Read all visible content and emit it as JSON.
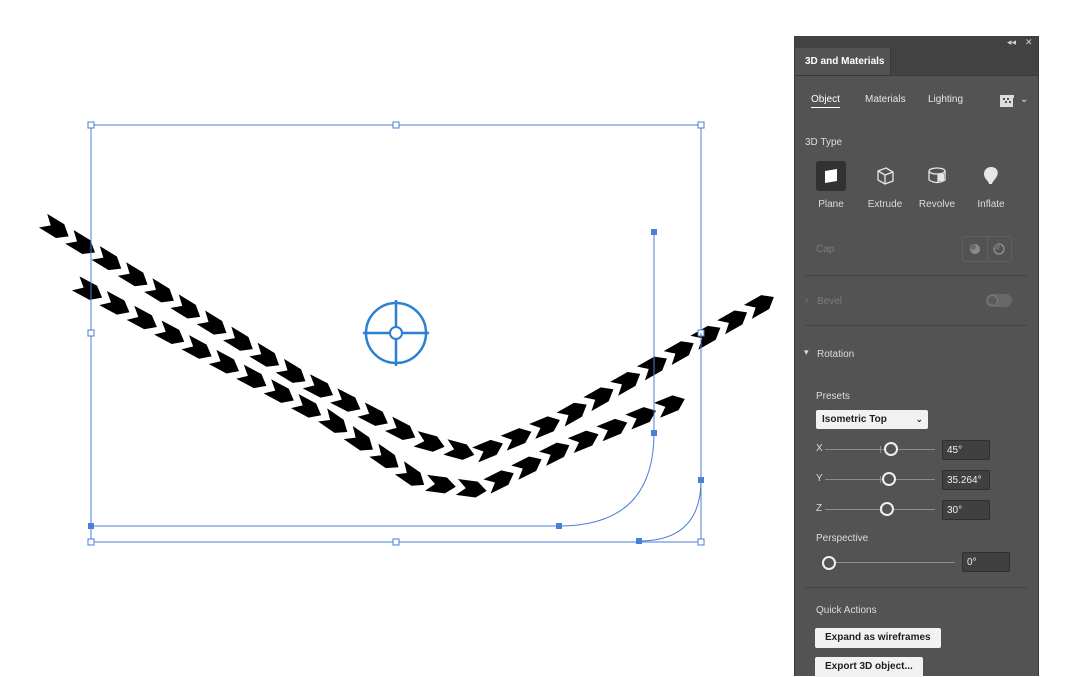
{
  "panel": {
    "title": "3D and Materials",
    "tabs": [
      {
        "label": "Object",
        "active": true
      },
      {
        "label": "Materials",
        "active": false
      },
      {
        "label": "Lighting",
        "active": false
      }
    ],
    "type_section": {
      "heading": "3D Type",
      "types": [
        {
          "label": "Plane",
          "icon": "plane-icon",
          "selected": true
        },
        {
          "label": "Extrude",
          "icon": "extrude-icon",
          "selected": false
        },
        {
          "label": "Revolve",
          "icon": "revolve-icon",
          "selected": false
        },
        {
          "label": "Inflate",
          "icon": "inflate-icon",
          "selected": false
        }
      ]
    },
    "cap_label": "Cap",
    "bevel": {
      "label": "Bevel",
      "enabled": false
    },
    "rotation": {
      "label": "Rotation",
      "presets_label": "Presets",
      "preset_value": "Isometric Top",
      "x": {
        "label": "X",
        "value": "45°",
        "slider_fraction": 0.49
      },
      "y": {
        "label": "Y",
        "value": "35.264°",
        "slider_fraction": 0.48
      },
      "z": {
        "label": "Z",
        "value": "30°",
        "slider_fraction": 0.46
      },
      "perspective_label": "Perspective",
      "perspective_value": "0°",
      "perspective_fraction": 0.0
    },
    "quick_actions": {
      "label": "Quick Actions",
      "expand_button": "Expand as wireframes",
      "export_button": "Export 3D object..."
    }
  },
  "colors": {
    "panel_bg": "#535353",
    "selection_blue": "#4a7fd8",
    "target_blue": "#2b7fd4",
    "art_fill": "#000000"
  }
}
